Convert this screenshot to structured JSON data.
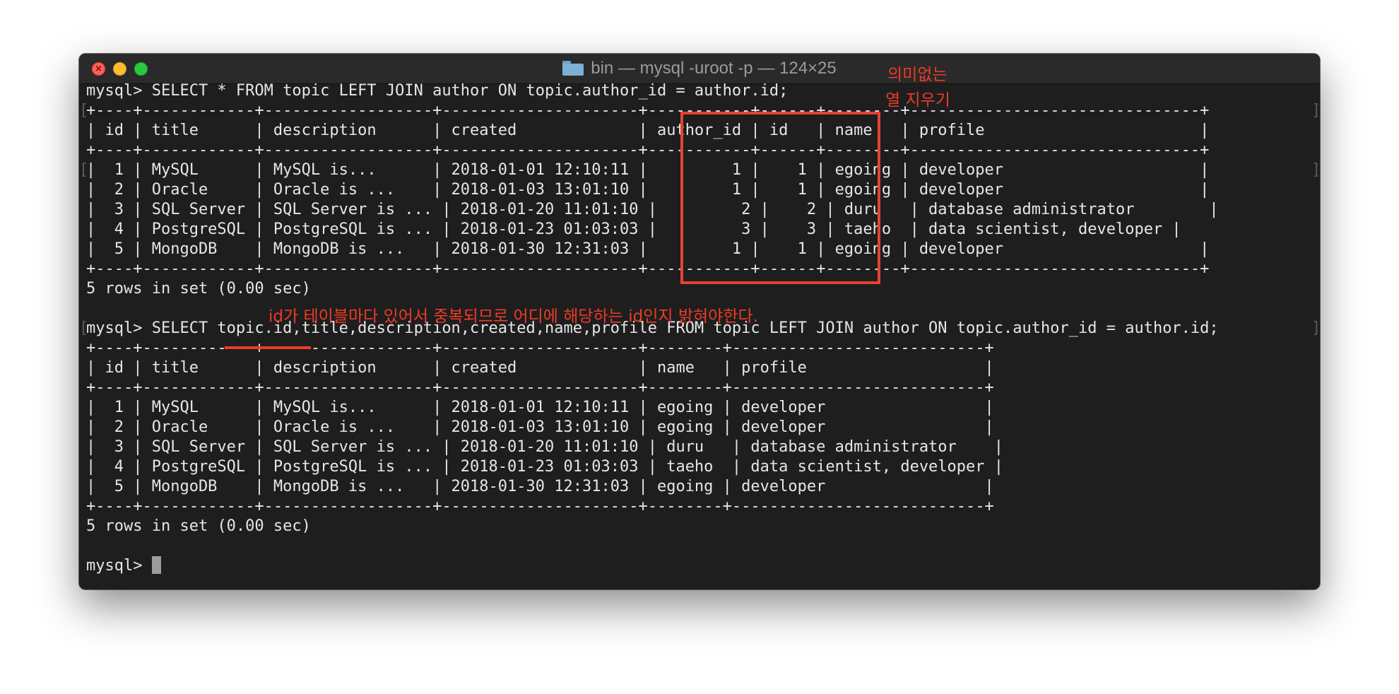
{
  "window": {
    "title": "bin — mysql -uroot -p — 124×25",
    "close_glyph": "×",
    "folder_icon": "folder-icon"
  },
  "terminal": {
    "lines": [
      "mysql> SELECT * FROM topic LEFT JOIN author ON topic.author_id = author.id;",
      "+----+------------+------------------+---------------------+-----------+------+--------+-------------------------------+",
      "| id | title      | description      | created             | author_id | id   | name   | profile                       |",
      "+----+------------+------------------+---------------------+-----------+------+--------+-------------------------------+",
      "|  1 | MySQL      | MySQL is...      | 2018-01-01 12:10:11 |         1 |    1 | egoing | developer                     |",
      "|  2 | Oracle     | Oracle is ...    | 2018-01-03 13:01:10 |         1 |    1 | egoing | developer                     |",
      "|  3 | SQL Server | SQL Server is ... | 2018-01-20 11:01:10 |         2 |    2 | duru   | database administrator        |",
      "|  4 | PostgreSQL | PostgreSQL is ... | 2018-01-23 01:03:03 |         3 |    3 | taeho  | data scientist, developer |",
      "|  5 | MongoDB    | MongoDB is ...   | 2018-01-30 12:31:03 |         1 |    1 | egoing | developer                     |",
      "+----+------------+------------------+---------------------+-----------+------+--------+-------------------------------+",
      "5 rows in set (0.00 sec)",
      "",
      "mysql> SELECT topic.id,title,description,created,name,profile FROM topic LEFT JOIN author ON topic.author_id = author.id;",
      "+----+------------+------------------+---------------------+--------+---------------------------+",
      "| id | title      | description      | created             | name   | profile                   |",
      "+----+------------+------------------+---------------------+--------+---------------------------+",
      "|  1 | MySQL      | MySQL is...      | 2018-01-01 12:10:11 | egoing | developer                 |",
      "|  2 | Oracle     | Oracle is ...    | 2018-01-03 13:01:10 | egoing | developer                 |",
      "|  3 | SQL Server | SQL Server is ... | 2018-01-20 11:01:10 | duru   | database administrator    |",
      "|  4 | PostgreSQL | PostgreSQL is ... | 2018-01-23 01:03:03 | taeho  | data scientist, developer |",
      "|  5 | MongoDB    | MongoDB is ...   | 2018-01-30 12:31:03 | egoing | developer                 |",
      "+----+------------+------------------+---------------------+--------+---------------------------+",
      "5 rows in set (0.00 sec)",
      "",
      "mysql> "
    ],
    "gutter_left": "[",
    "gutter_right": "]"
  },
  "annotations": {
    "meaningless_cols_line1": "의미없는",
    "meaningless_cols_line2": "열 지우기",
    "duplicate_id_note": "id가 테이블마다 있어서 중복되므로 어디에 해당하는 id인지 밝혀야한다."
  },
  "colors": {
    "annotation_red": "#ef3a25",
    "terminal_bg": "#1e1e1e",
    "terminal_text": "#e6e6e6"
  }
}
